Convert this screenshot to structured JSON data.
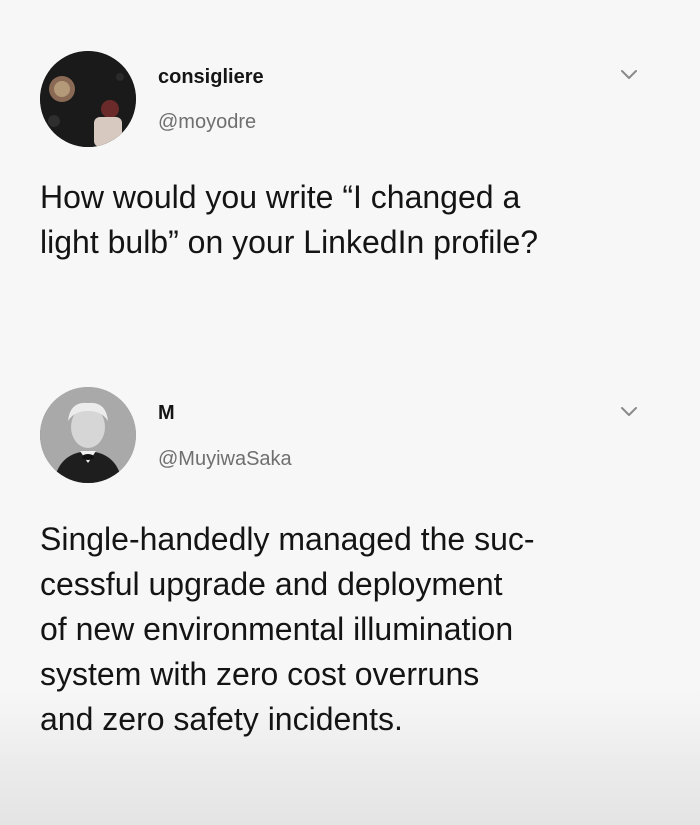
{
  "tweets": [
    {
      "display_name": "consigliere",
      "handle": "@moyodre",
      "avatar_icon": "avatar-photo-icon",
      "menu_icon": "chevron-down-icon",
      "text_lines": [
        "How would you write “I changed a",
        "light bulb” on your LinkedIn profile?"
      ]
    },
    {
      "display_name": "M",
      "handle": "@MuyiwaSaka",
      "avatar_icon": "avatar-portrait-icon",
      "menu_icon": "chevron-down-icon",
      "text_lines": [
        "Single-handedly managed the suc-",
        "cessful upgrade and deployment",
        "of new environmental illumination",
        "system with zero cost overruns",
        "and zero safety incidents."
      ]
    }
  ],
  "colors": {
    "text": "#141414",
    "handle": "#6f6f6f",
    "background": "#f7f7f7"
  }
}
